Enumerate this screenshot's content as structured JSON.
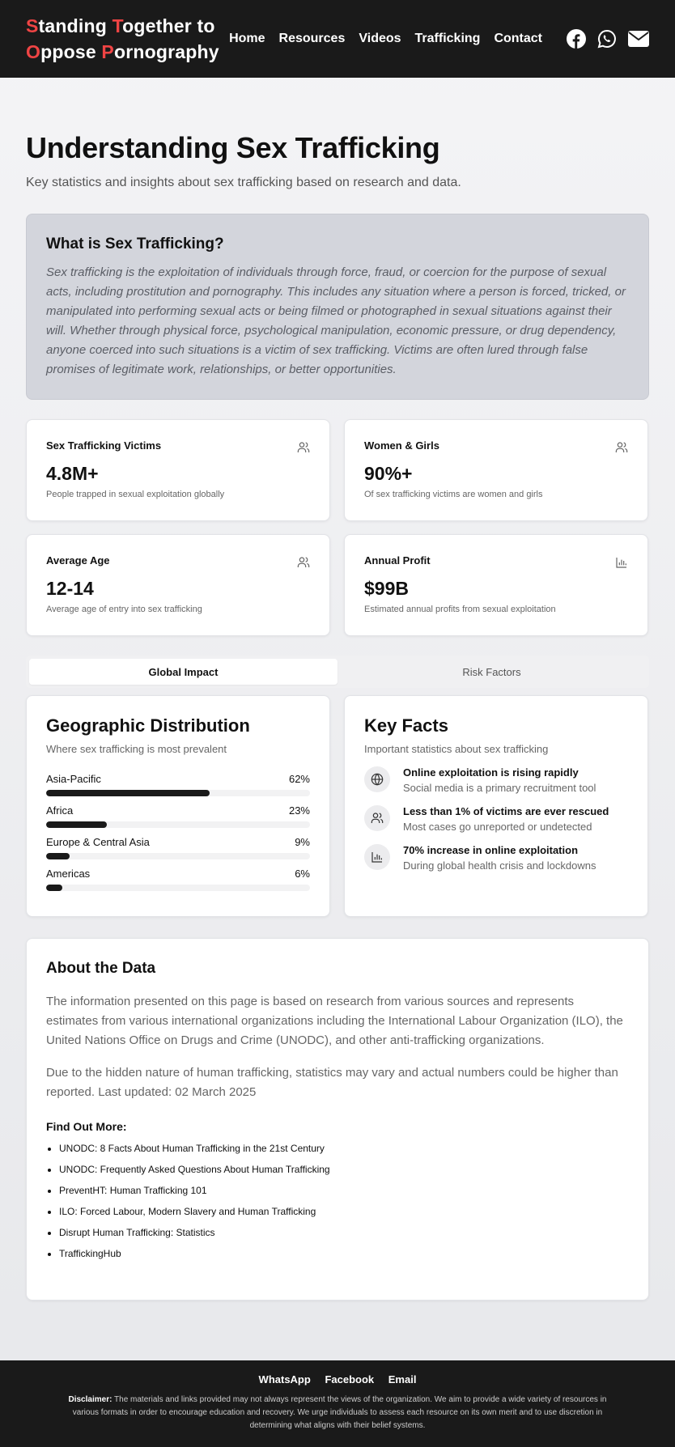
{
  "header": {
    "logo_line1": [
      "S",
      "tanding ",
      "T",
      "ogether to"
    ],
    "logo_line2": [
      "O",
      "ppose ",
      "P",
      "ornography"
    ],
    "nav": [
      "Home",
      "Resources",
      "Videos",
      "Trafficking",
      "Contact"
    ],
    "social_icons": [
      "facebook-icon",
      "whatsapp-icon",
      "email-icon"
    ]
  },
  "hero": {
    "title": "Understanding Sex Trafficking",
    "subtitle": "Key statistics and insights about sex trafficking based on research and data."
  },
  "definition": {
    "title": "What is Sex Trafficking?",
    "text": "Sex trafficking is the exploitation of individuals through force, fraud, or coercion for the purpose of sexual acts, including prostitution and pornography. This includes any situation where a person is forced, tricked, or manipulated into performing sexual acts or being filmed or photographed in sexual situations against their will. Whether through physical force, psychological manipulation, economic pressure, or drug dependency, anyone coerced into such situations is a victim of sex trafficking. Victims are often lured through false promises of legitimate work, relationships, or better opportunities."
  },
  "stats": [
    {
      "label": "Sex Trafficking Victims",
      "value": "4.8M+",
      "desc": "People trapped in sexual exploitation globally",
      "icon": "users-icon"
    },
    {
      "label": "Women & Girls",
      "value": "90%+",
      "desc": "Of sex trafficking victims are women and girls",
      "icon": "users-icon"
    },
    {
      "label": "Average Age",
      "value": "12-14",
      "desc": "Average age of entry into sex trafficking",
      "icon": "users-icon"
    },
    {
      "label": "Annual Profit",
      "value": "$99B",
      "desc": "Estimated annual profits from sexual exploitation",
      "icon": "bar-chart-icon"
    }
  ],
  "tabs": [
    "Global Impact",
    "Risk Factors"
  ],
  "geo": {
    "title": "Geographic Distribution",
    "subtitle": "Where sex trafficking is most prevalent",
    "regions": [
      {
        "name": "Asia-Pacific",
        "pct_label": "62%",
        "pct": 62
      },
      {
        "name": "Africa",
        "pct_label": "23%",
        "pct": 23
      },
      {
        "name": "Europe & Central Asia",
        "pct_label": "9%",
        "pct": 9
      },
      {
        "name": "Americas",
        "pct_label": "6%",
        "pct": 6
      }
    ]
  },
  "facts": {
    "title": "Key Facts",
    "subtitle": "Important statistics about sex trafficking",
    "items": [
      {
        "title": "Online exploitation is rising rapidly",
        "sub": "Social media is a primary recruitment tool",
        "icon": "globe-icon"
      },
      {
        "title": "Less than 1% of victims are ever rescued",
        "sub": "Most cases go unreported or undetected",
        "icon": "users-icon"
      },
      {
        "title": "70% increase in online exploitation",
        "sub": "During global health crisis and lockdowns",
        "icon": "bar-chart-icon"
      }
    ]
  },
  "about": {
    "title": "About the Data",
    "p1": "The information presented on this page is based on research from various sources and represents estimates from various international organizations including the International Labour Organization (ILO), the United Nations Office on Drugs and Crime (UNODC), and other anti-trafficking organizations.",
    "p2": "Due to the hidden nature of human trafficking, statistics may vary and actual numbers could be higher than reported. Last updated: 02 March 2025",
    "more_title": "Find Out More:",
    "links": [
      "UNODC: 8 Facts About Human Trafficking in the 21st Century",
      "UNODC: Frequently Asked Questions About Human Trafficking",
      "PreventHT: Human Trafficking 101",
      "ILO: Forced Labour, Modern Slavery and Human Trafficking",
      "Disrupt Human Trafficking: Statistics",
      "TraffickingHub"
    ]
  },
  "footer": {
    "links": [
      "WhatsApp",
      "Facebook",
      "Email"
    ],
    "disclaimer_label": "Disclaimer:",
    "disclaimer": "The materials and links provided may not always represent the views of the organization. We aim to provide a wide variety of resources in various formats in order to encourage education and recovery. We urge individuals to assess each resource on its own merit and to use discretion in determining what aligns with their belief systems."
  }
}
